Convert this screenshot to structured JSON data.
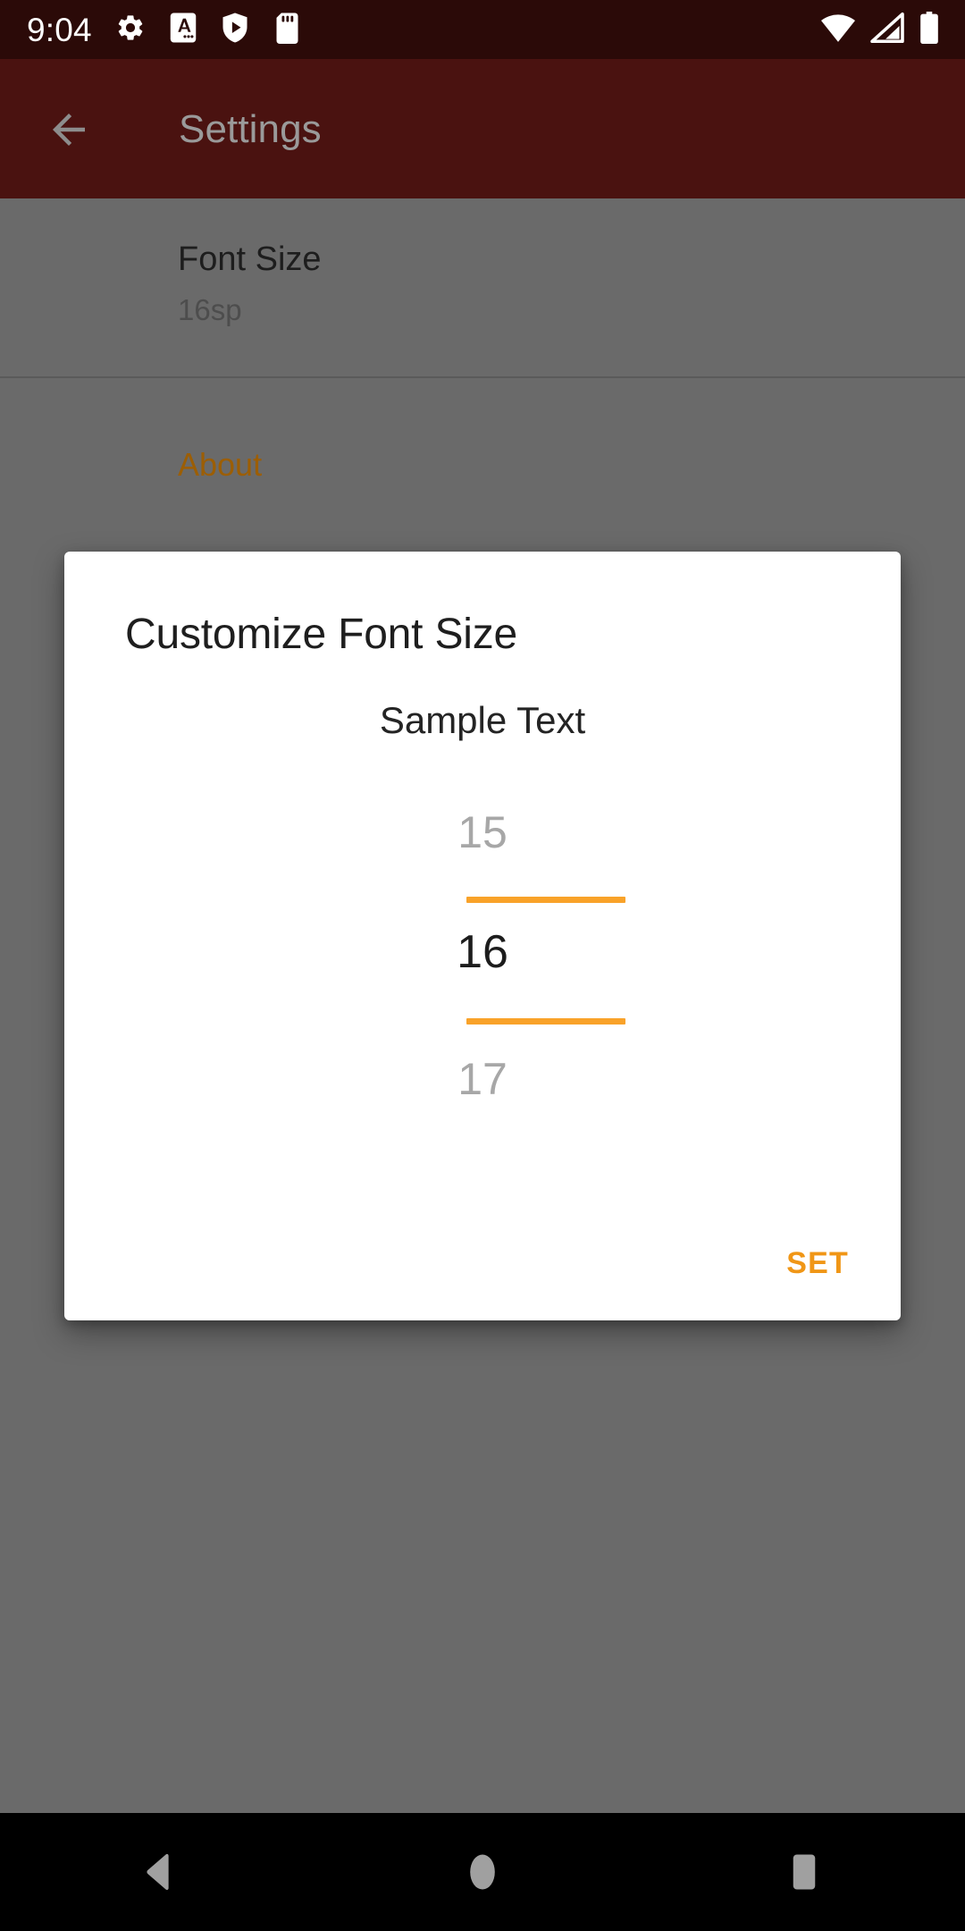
{
  "status_bar": {
    "clock": "9:04",
    "left_icons": [
      {
        "name": "settings-gear-icon",
        "glyph": "gear"
      },
      {
        "name": "font-a-icon",
        "glyph": "a-box"
      },
      {
        "name": "shield-play-icon",
        "glyph": "shield-play"
      },
      {
        "name": "sd-card-icon",
        "glyph": "sd-card"
      }
    ],
    "right_icons": [
      {
        "name": "wifi-icon",
        "glyph": "wifi"
      },
      {
        "name": "cellular-signal-icon",
        "glyph": "signal"
      },
      {
        "name": "battery-icon",
        "glyph": "battery"
      }
    ],
    "background_color": "#2b0a08"
  },
  "app_bar": {
    "title": "Settings",
    "back_label": "Navigate up",
    "background_color": "#4a1210",
    "title_color": "#9a9a9a"
  },
  "settings": {
    "preferences": [
      {
        "title": "Font Size",
        "summary": "16sp"
      }
    ],
    "section_header": "About",
    "section_header_color": "#9c5e04",
    "scrim_color": "#6a6a6a"
  },
  "dialog": {
    "title": "Customize Font Size",
    "sample_text": "Sample Text",
    "picker": {
      "previous_value": "15",
      "current_value": "16",
      "next_value": "17",
      "selection_line_color": "#f9a229"
    },
    "buttons": {
      "positive": "SET"
    },
    "accent_color": "#f09616",
    "background_color": "#ffffff"
  },
  "nav_bar": {
    "background_color": "#000000",
    "buttons": [
      {
        "name": "nav-back-button",
        "label": "Back"
      },
      {
        "name": "nav-home-button",
        "label": "Home"
      },
      {
        "name": "nav-recents-button",
        "label": "Recents"
      }
    ]
  }
}
